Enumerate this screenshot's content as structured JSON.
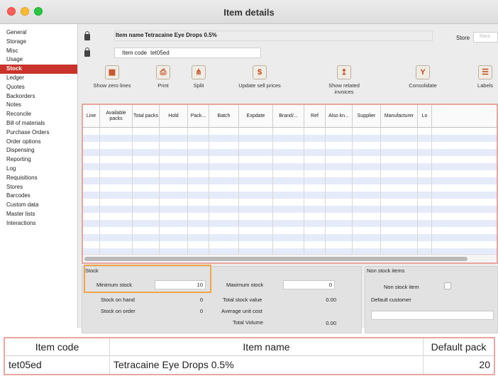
{
  "window": {
    "title": "Item details"
  },
  "sidebar": {
    "items": [
      {
        "label": "General"
      },
      {
        "label": "Storage"
      },
      {
        "label": "Misc"
      },
      {
        "label": "Usage"
      },
      {
        "label": "Stock",
        "active": true
      },
      {
        "label": "Ledger"
      },
      {
        "label": "Quotes"
      },
      {
        "label": "Backorders"
      },
      {
        "label": "Notes"
      },
      {
        "label": "Reconcile"
      },
      {
        "label": "Bill of materials"
      },
      {
        "label": "Purchase Orders"
      },
      {
        "label": "Order options"
      },
      {
        "label": "Dispensing"
      },
      {
        "label": "Reporting"
      },
      {
        "label": "Log"
      },
      {
        "label": "Requisitions"
      },
      {
        "label": "Stores"
      },
      {
        "label": "Barcodes"
      },
      {
        "label": "Custom data"
      },
      {
        "label": "Master lists"
      },
      {
        "label": "Interactions"
      }
    ]
  },
  "header": {
    "item_name_label": "Item name",
    "item_name_value": "Tetracaine Eye Drops 0.5%",
    "item_code_label": "Item code",
    "item_code_value": "tet05ed",
    "store_label": "Store",
    "store_value": "Rani"
  },
  "toolbar": {
    "show_zero_lines": "Show zero lines",
    "print": "Print",
    "split": "Split",
    "update_sell_prices": "Update sell prices",
    "show_related_invoices_1": "Show related",
    "show_related_invoices_2": "invoices",
    "consolidate": "Consolidate",
    "labels": "Labels"
  },
  "grid": {
    "columns": [
      {
        "label": "Line"
      },
      {
        "label": "Available packs"
      },
      {
        "label": "Total packs"
      },
      {
        "label": "Hold"
      },
      {
        "label": "Pack..."
      },
      {
        "label": "Batch"
      },
      {
        "label": "Expdate"
      },
      {
        "label": "Brand/..."
      },
      {
        "label": "Ref"
      },
      {
        "label": "Also kn..."
      },
      {
        "label": "Supplier"
      },
      {
        "label": "Manufacturer"
      },
      {
        "label": "Lo"
      }
    ]
  },
  "stock": {
    "title": "Stock",
    "minimum_stock_label": "Minimum stock",
    "minimum_stock_value": "10",
    "maximum_stock_label": "Maximum stock",
    "maximum_stock_value": "0",
    "stock_on_hand_label": "Stock on hand",
    "stock_on_hand_value": "0",
    "total_stock_value_label": "Total stock value",
    "total_stock_value_value": "0.00",
    "stock_on_order_label": "Stock on order",
    "stock_on_order_value": "0",
    "average_unit_cost_label": "Average unit cost",
    "total_volume_label": "Total Volume",
    "total_volume_value": "0.00"
  },
  "non_stock": {
    "title": "Non stock items",
    "non_stock_item_label": "Non stock item",
    "default_customer_label": "Default customer"
  },
  "bottom_table": {
    "headers": {
      "item_code": "Item code",
      "item_name": "Item name",
      "default_pack": "Default pack"
    },
    "row": {
      "item_code": "tet05ed",
      "item_name": "Tetracaine Eye Drops 0.5%",
      "default_pack": "20"
    }
  }
}
